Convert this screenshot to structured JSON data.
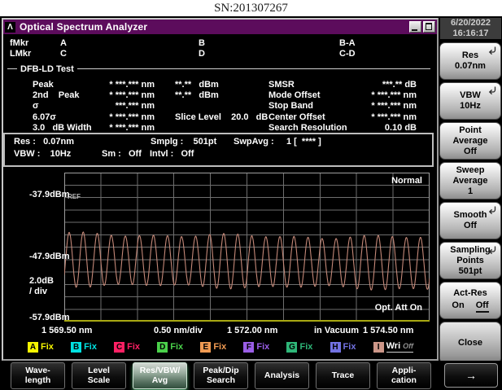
{
  "sn_label": "SN:201307267",
  "colors": {
    "purple": "#5c0c5c",
    "trace": "#c48878",
    "grid": "#6e6e6e",
    "graph_border": "#9e9e9e",
    "axis_yellow": "#a8a812"
  },
  "window": {
    "title": "Optical Spectrum Analyzer",
    "logo": "Λ"
  },
  "datetime": {
    "date": "6/20/2022",
    "time": "16:16:17"
  },
  "markers": {
    "rows": [
      [
        "fMkr",
        "A",
        "B",
        "B-A"
      ],
      [
        "LMkr",
        "C",
        "D",
        "C-D"
      ]
    ]
  },
  "dfb": {
    "section_title": "DFB-LD Test",
    "rows": [
      {
        "label": "Peak",
        "nm": "* ***.*** nm",
        "mid": "**.**   dBm",
        "rlabel": "SMSR",
        "rval": "***.** dB"
      },
      {
        "label": "2nd    Peak",
        "nm": "* ***.*** nm",
        "mid": "**.**   dBm",
        "rlabel": "Mode Offset",
        "rval": "* ***.*** nm"
      },
      {
        "label": "σ",
        "nm": "***.*** nm",
        "mid": "",
        "rlabel": "Stop Band",
        "rval": "* ***.*** nm"
      },
      {
        "label": "6.07σ",
        "nm": "* ***.*** nm",
        "mid": "Slice Level    20.0   dB",
        "rlabel": "Center Offset",
        "rval": "* ***.*** nm"
      },
      {
        "label": "3.0   dB Width",
        "nm": "* ***.*** nm",
        "mid": "",
        "rlabel": "Search Resolution",
        "rval": "0.10 dB"
      }
    ]
  },
  "status": {
    "row1": [
      "Res :   0.07nm",
      "Smplg :    501pt",
      "SwpAvg :     1 [  **** ]"
    ],
    "row2": [
      "VBW :    10Hz",
      "Sm :   Off",
      "Intvl :   Off"
    ]
  },
  "graph": {
    "mode_label": "Normal",
    "ref_label": "REF",
    "att_label": "Opt. Att On",
    "y_labels": [
      "-37.9dBm",
      "-47.9dBm",
      "2.0dB",
      "/ div",
      "-57.9dBm"
    ],
    "x_labels": [
      "1 569.50 nm",
      "0.50 nm/div",
      "1 572.00 nm",
      "in Vacuum",
      "1 574.50 nm"
    ]
  },
  "chart_data": {
    "type": "line",
    "title": "Optical spectrum trace I (DFB-LD mode-comb / fringe pattern)",
    "x_axis": {
      "start_nm": 1569.5,
      "center_nm": 1572.0,
      "stop_nm": 1574.5,
      "per_div_nm": 0.5,
      "divisions": 10,
      "medium": "in Vacuum"
    },
    "y_axis": {
      "ref_dbm": -37.9,
      "mid_dbm": -47.9,
      "bottom_dbm": -57.9,
      "per_div_db": 2.0,
      "top_edge_dbm": -33.9,
      "grid_rows": 12
    },
    "series": [
      {
        "name": "I",
        "mode": "Wri",
        "shape": "sinusoidal-fringes",
        "periods": 26,
        "peak_dbm": -43.7,
        "valley_dbm": -51.9,
        "right_edge_extra_drop_db": 0.6,
        "amplitude_db": 4.1,
        "center_dbm": -47.9
      }
    ],
    "annotations": [
      "Normal",
      "REF",
      "Opt. Att On"
    ],
    "grid": true,
    "legend_position": "bottom"
  },
  "legend": {
    "items": [
      {
        "letter": "A",
        "label": "Fix",
        "color": "#f5f500",
        "active": false
      },
      {
        "letter": "B",
        "label": "Fix",
        "color": "#00e0e0",
        "active": false
      },
      {
        "letter": "C",
        "label": "Fix",
        "color": "#ff2064",
        "active": false
      },
      {
        "letter": "D",
        "label": "Fix",
        "color": "#4ad04a",
        "active": false
      },
      {
        "letter": "E",
        "label": "Fix",
        "color": "#f09a52",
        "active": false
      },
      {
        "letter": "F",
        "label": "Fix",
        "color": "#9a5ee6",
        "active": false
      },
      {
        "letter": "G",
        "label": "Fix",
        "color": "#2eb678",
        "active": false
      },
      {
        "letter": "H",
        "label": "Fix",
        "color": "#7272e2",
        "active": false
      },
      {
        "letter": "I",
        "label": "Wri",
        "suffix": "Off",
        "color": "#cc9688",
        "active": true
      }
    ]
  },
  "softkeys": {
    "buttons": [
      {
        "id": "res",
        "lines": [
          "Res",
          "0.07nm"
        ],
        "arrow": true
      },
      {
        "id": "vbw",
        "lines": [
          "VBW",
          "10Hz"
        ],
        "arrow": true
      },
      {
        "id": "point-average",
        "lines": [
          "Point",
          "Average",
          "Off"
        ],
        "arrow": false
      },
      {
        "id": "sweep-average",
        "lines": [
          "Sweep",
          "Average",
          "1"
        ],
        "arrow": false
      },
      {
        "id": "smooth",
        "lines": [
          "Smooth",
          "Off"
        ],
        "arrow": true
      },
      {
        "id": "sampling-points",
        "lines": [
          "Sampling",
          "Points",
          "501pt"
        ],
        "arrow": true
      },
      {
        "id": "act-res",
        "toggle": {
          "title": "Act-Res",
          "on": "On",
          "off": "Off",
          "selected": "Off"
        },
        "arrow": false
      },
      {
        "id": "close",
        "lines": [
          "Close"
        ],
        "arrow": false
      }
    ]
  },
  "function_keys": {
    "items": [
      {
        "lines": [
          "Wave-",
          "length"
        ],
        "selected": false
      },
      {
        "lines": [
          "Level",
          "Scale"
        ],
        "selected": false
      },
      {
        "lines": [
          "Res/VBW/",
          "Avg"
        ],
        "selected": true
      },
      {
        "lines": [
          "Peak/Dip",
          "Search"
        ],
        "selected": false
      },
      {
        "lines": [
          "Analysis"
        ],
        "selected": false
      },
      {
        "lines": [
          "Trace"
        ],
        "selected": false
      },
      {
        "lines": [
          "Appli-",
          "cation"
        ],
        "selected": false
      }
    ],
    "arrow_label": "→"
  }
}
